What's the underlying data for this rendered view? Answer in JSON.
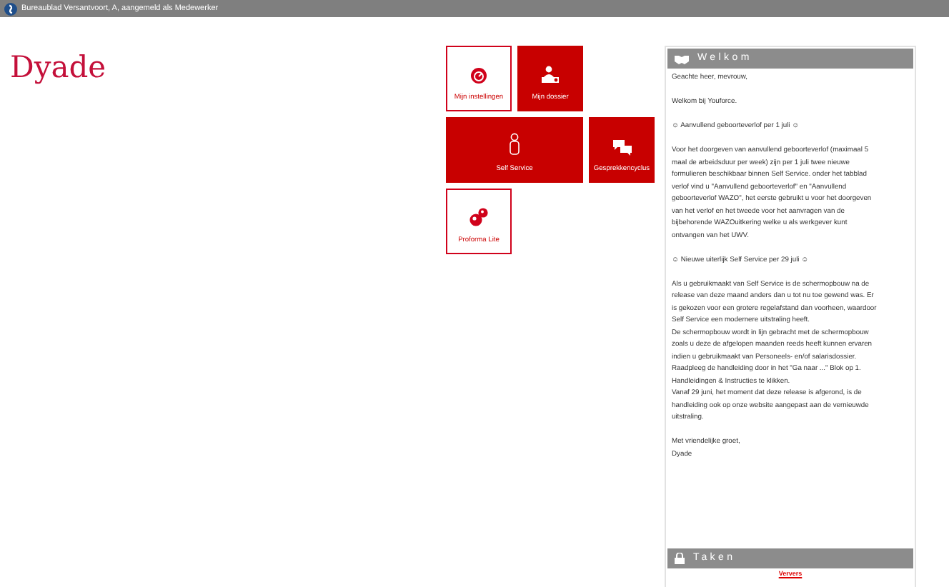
{
  "window": {
    "title": "Bureaublad  Versantvoort, A, aangemeld als Medewerker"
  },
  "logo": "Dyade",
  "tiles": [
    {
      "label": "Mijn instellingen",
      "kind": "outline",
      "wide": false
    },
    {
      "label": "Mijn dossier",
      "kind": "filled",
      "wide": false
    },
    {
      "label": "Self Service",
      "kind": "filled",
      "wide": true
    },
    {
      "label": "Gesprekkencyclus",
      "kind": "filled",
      "wide": false
    },
    {
      "label": "Proforma Lite",
      "kind": "outline",
      "wide": false
    }
  ],
  "welcome_panel": {
    "title": "Welkom",
    "paragraphs": [
      [
        "Geachte heer, mevrouw,"
      ],
      [
        "Welkom bij Youforce."
      ],
      [
        "☺ Aanvullend geboorteverlof per 1 juli ☺"
      ],
      [
        "Voor het doorgeven van aanvullend geboorteverlof (maximaal 5 maal de arbeidsduur per week) zijn per 1 juli twee nieuwe formulieren beschikbaar binnen Self Service. onder het tabblad verlof vind u \"Aanvullend geboorteverlof\" en \"Aanvullend geboorteverlof WAZO\", het eerste gebruikt u voor het doorgeven van het verlof en het tweede voor het aanvragen van de bijbehorende WAZOuitkering welke u als werkgever kunt ontvangen van het UWV."
      ],
      [
        "☺ Nieuwe uiterlijk Self Service per 29 juli ☺"
      ],
      [
        "Als u gebruikmaakt van Self Service is de schermopbouw na de release van deze maand anders dan u tot nu toe gewend was. Er is gekozen voor een grotere regelafstand dan voorheen, waardoor Self Service een modernere uitstraling heeft.",
        "De schermopbouw wordt in lijn gebracht met de schermopbouw zoals u deze de afgelopen maanden reeds heeft kunnen ervaren indien u gebruikmaakt van Personeels- en/of salarisdossier.",
        "Raadpleeg de handleiding door in het \"Ga naar ...\" Blok op 1. Handleidingen & Instructies te klikken.",
        "Vanaf 29 juni, het moment dat deze release is afgerond, is de handleiding ook op onze website aangepast aan de vernieuwde uitstraling."
      ],
      [
        "Met vriendelijke groet,",
        "Dyade"
      ]
    ]
  },
  "tasks_panel": {
    "title": "Taken",
    "refresh_link": "Ververs"
  }
}
